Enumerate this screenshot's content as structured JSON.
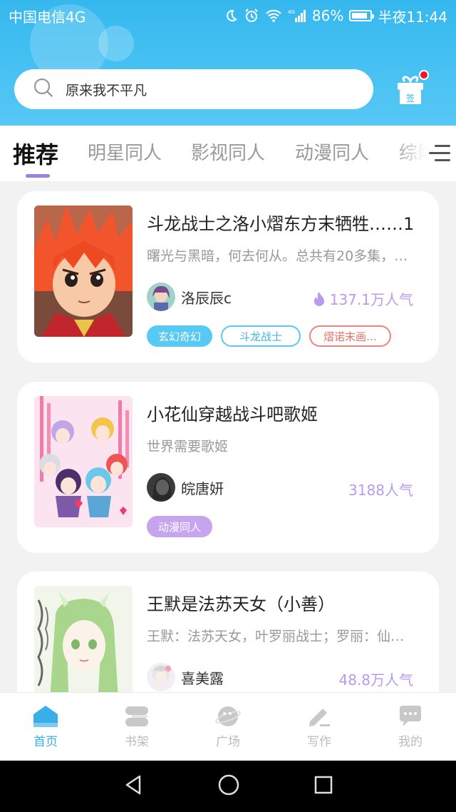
{
  "status_bar": {
    "carrier": "中国电信4G",
    "network": "4G",
    "battery": "86%",
    "battery_level": 0.86,
    "time": "半夜11:44"
  },
  "search": {
    "text": "原来我不平凡"
  },
  "gift": {
    "label": "签"
  },
  "tabs": [
    {
      "label": "推荐",
      "active": true
    },
    {
      "label": "明星同人"
    },
    {
      "label": "影视同人"
    },
    {
      "label": "动漫同人"
    },
    {
      "label": "综影"
    }
  ],
  "books": [
    {
      "title": "斗龙战士之洛小熠东方末牺牲……1",
      "description": "曙光与黑暗，何去何从。总共有20多集，…",
      "author": "洛辰辰c",
      "popularity": "137.1万人气",
      "tags": [
        "玄幻奇幻",
        "斗龙战士",
        "熠诺末画…"
      ]
    },
    {
      "title": "小花仙穿越战斗吧歌姬",
      "description": "世界需要歌姬",
      "author": "皖唐妍",
      "popularity": "3188人气",
      "tags": [
        "动漫同人"
      ]
    },
    {
      "title": "王默是法苏天女（小善）",
      "description": "王默：法苏天女，叶罗丽战士；罗丽：仙…",
      "author": "喜美露",
      "popularity": "48.8万人气",
      "tags": []
    }
  ],
  "bottom_nav": [
    {
      "label": "首页",
      "icon": "home-icon",
      "active": true
    },
    {
      "label": "书架",
      "icon": "bookshelf-icon"
    },
    {
      "label": "广场",
      "icon": "planet-icon"
    },
    {
      "label": "写作",
      "icon": "pen-icon"
    },
    {
      "label": "我的",
      "icon": "chat-bubble-icon"
    }
  ],
  "colors": {
    "header": "#35b8ee",
    "accent_purple": "#9b7fe6",
    "nav_active": "#3aaee9",
    "popularity": "#b79bf0"
  }
}
